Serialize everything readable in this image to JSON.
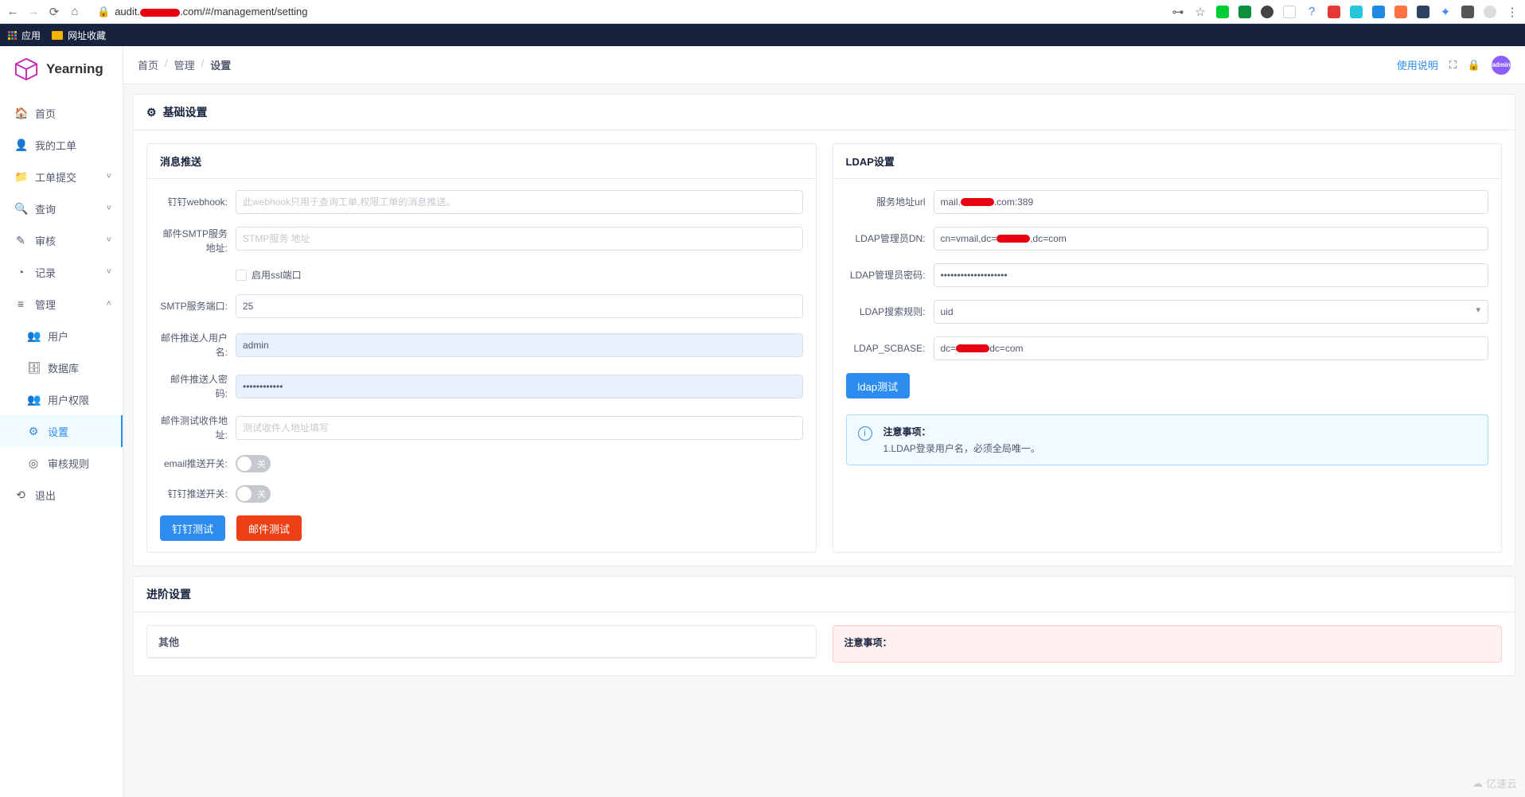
{
  "chrome": {
    "url_prefix": "audit.",
    "url_suffix": ".com/#/management/setting",
    "bookmarks": {
      "apps": "应用",
      "fav": "网址收藏"
    }
  },
  "app_name": "Yearning",
  "breadcrumb": {
    "home": "首页",
    "manage": "管理",
    "setting": "设置"
  },
  "topbar": {
    "help": "使用说明",
    "avatar": "admin"
  },
  "sidebar": {
    "home": "首页",
    "my_orders": "我的工单",
    "order_submit": "工单提交",
    "query": "查询",
    "review": "审核",
    "record": "记录",
    "manage": "管理",
    "user": "用户",
    "database": "数据库",
    "user_perm": "用户权限",
    "setting": "设置",
    "audit_rule": "审核规则",
    "logout": "退出"
  },
  "card_basic_title": "基础设置",
  "panel_push": {
    "title": "消息推送",
    "webhook_label": "钉钉webhook:",
    "webhook_placeholder": "此webhook只用于查询工单,权限工单的消息推送。",
    "smtp_addr_label": "邮件SMTP服务地址:",
    "smtp_addr_placeholder": "STMP服务 地址",
    "ssl_label": "启用ssl端口",
    "smtp_port_label": "SMTP服务端口:",
    "smtp_port_value": "25",
    "push_user_label": "邮件推送人用户名:",
    "push_user_value": "admin",
    "push_pass_label": "邮件推送人密码:",
    "push_pass_value": "••••••••••••",
    "test_addr_label": "邮件测试收件地址:",
    "test_addr_placeholder": "测试收件人地址填写",
    "email_switch_label": "email推送开关:",
    "ding_switch_label": "钉钉推送开关:",
    "switch_off": "关",
    "btn_ding": "钉钉测试",
    "btn_mail": "邮件测试"
  },
  "panel_ldap": {
    "title": "LDAP设置",
    "url_label": "服务地址url",
    "url_prefix": "mail.",
    "url_suffix": ".com:389",
    "dn_label": "LDAP管理员DN:",
    "dn_prefix": "cn=vmail,dc=",
    "dn_suffix": ",dc=com",
    "pass_label": "LDAP管理员密码:",
    "pass_value": "••••••••••••••••••••",
    "search_label": "LDAP搜索规则:",
    "search_value": "uid",
    "scbase_label": "LDAP_SCBASE:",
    "scbase_prefix": "dc=",
    "scbase_suffix": "dc=com",
    "btn_test": "ldap测试",
    "notice_title": "注意事项：",
    "notice_body": "1.LDAP登录用户名，必须全局唯一。"
  },
  "card_adv_title": "进阶设置",
  "sub_other": "其他",
  "adv_notice_title": "注意事项：",
  "watermark": "亿速云"
}
